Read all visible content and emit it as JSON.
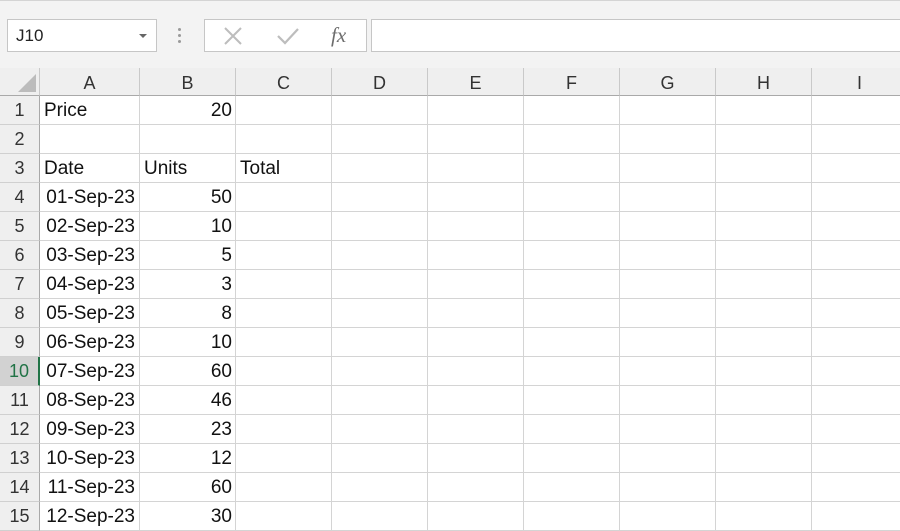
{
  "namebox": {
    "value": "J10"
  },
  "formula_bar": {
    "fx_label": "fx",
    "content": ""
  },
  "columns": [
    "A",
    "B",
    "C",
    "D",
    "E",
    "F",
    "G",
    "H",
    "I"
  ],
  "selected_row": "10",
  "rows": [
    {
      "num": "1",
      "cells": [
        "Price",
        "20",
        ""
      ]
    },
    {
      "num": "2",
      "cells": [
        "",
        "",
        ""
      ]
    },
    {
      "num": "3",
      "cells": [
        "Date",
        "Units",
        "Total"
      ]
    },
    {
      "num": "4",
      "cells": [
        "01-Sep-23",
        "50",
        ""
      ]
    },
    {
      "num": "5",
      "cells": [
        "02-Sep-23",
        "10",
        ""
      ]
    },
    {
      "num": "6",
      "cells": [
        "03-Sep-23",
        "5",
        ""
      ]
    },
    {
      "num": "7",
      "cells": [
        "04-Sep-23",
        "3",
        ""
      ]
    },
    {
      "num": "8",
      "cells": [
        "05-Sep-23",
        "8",
        ""
      ]
    },
    {
      "num": "9",
      "cells": [
        "06-Sep-23",
        "10",
        ""
      ]
    },
    {
      "num": "10",
      "cells": [
        "07-Sep-23",
        "60",
        ""
      ]
    },
    {
      "num": "11",
      "cells": [
        "08-Sep-23",
        "46",
        ""
      ]
    },
    {
      "num": "12",
      "cells": [
        "09-Sep-23",
        "23",
        ""
      ]
    },
    {
      "num": "13",
      "cells": [
        "10-Sep-23",
        "12",
        ""
      ]
    },
    {
      "num": "14",
      "cells": [
        "11-Sep-23",
        "60",
        ""
      ]
    },
    {
      "num": "15",
      "cells": [
        "12-Sep-23",
        "30",
        ""
      ]
    }
  ],
  "colors": {
    "accent": "#217346",
    "header_bg": "#efefef",
    "gridline": "#d4d4d4"
  },
  "icons": [
    "dropdown-arrow-icon",
    "cancel-x-icon",
    "enter-check-icon",
    "insert-function-icon",
    "grip-dots-icon",
    "select-all-triangle-icon"
  ]
}
